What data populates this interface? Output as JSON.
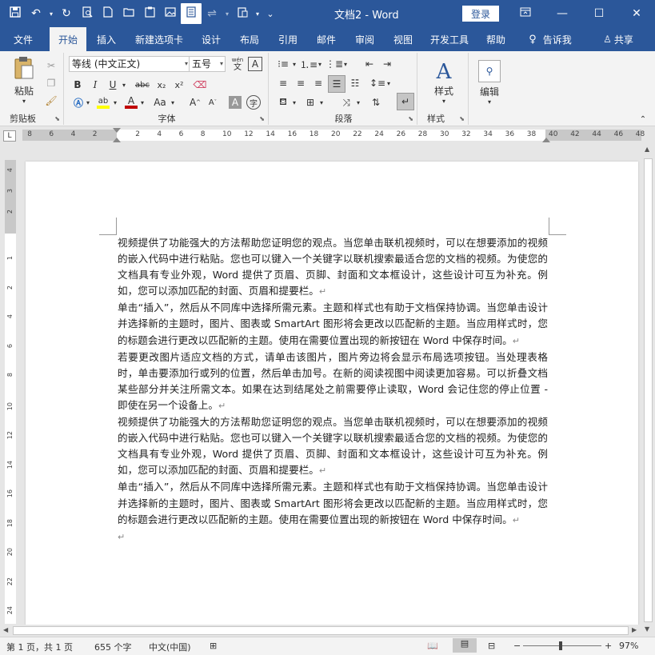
{
  "title": {
    "doc_name": "文档2",
    "sep": " - ",
    "app": "Word",
    "login": "登录"
  },
  "tabs": [
    "文件",
    "开始",
    "插入",
    "新建选项卡",
    "设计",
    "布局",
    "引用",
    "邮件",
    "审阅",
    "视图",
    "开发工具",
    "帮助"
  ],
  "tell_me": "告诉我",
  "share": "共享",
  "ribbon": {
    "clipboard": {
      "paste": "粘贴",
      "label": "剪贴板"
    },
    "font": {
      "label": "字体",
      "font_name": "等线 (中文正文)",
      "font_size": "五号",
      "wen": "wén",
      "bold": "B",
      "italic": "I",
      "underline": "U",
      "strike": "abc",
      "sub": "x₂",
      "sup": "x²",
      "case": "Aa",
      "grow": "A",
      "shrink": "A",
      "char_border": "A",
      "char_shading": "A",
      "phonetic": "A",
      "highlight": "ab",
      "font_color": "A"
    },
    "paragraph": {
      "label": "段落"
    },
    "styles": {
      "label": "样式",
      "btn": "样式"
    },
    "editing": {
      "btn": "编辑"
    }
  },
  "ruler": {
    "h_left": [
      "8",
      "6",
      "4",
      "2"
    ],
    "h_right": [
      "2",
      "4",
      "6",
      "8",
      "10",
      "12",
      "14",
      "16",
      "18",
      "20",
      "22",
      "24",
      "26",
      "28",
      "30",
      "32",
      "34",
      "36",
      "38",
      "40",
      "42",
      "44",
      "46",
      "48"
    ],
    "v": [
      "4",
      "3",
      "2",
      "1",
      "2",
      "4",
      "6",
      "8",
      "10",
      "12",
      "14",
      "16",
      "18",
      "20",
      "22",
      "24"
    ]
  },
  "document": {
    "paragraphs": [
      "视频提供了功能强大的方法帮助您证明您的观点。当您单击联机视频时，可以在想要添加的视频的嵌入代码中进行粘贴。您也可以键入一个关键字以联机搜索最适合您的文档的视频。为使您的文档具有专业外观，Word 提供了页眉、页脚、封面和文本框设计，这些设计可互为补充。例如，您可以添加匹配的封面、页眉和提要栏。",
      "单击“插入”，然后从不同库中选择所需元素。主题和样式也有助于文档保持协调。当您单击设计并选择新的主题时，图片、图表或 SmartArt 图形将会更改以匹配新的主题。当应用样式时，您的标题会进行更改以匹配新的主题。使用在需要位置出现的新按钮在 Word 中保存时间。",
      "若要更改图片适应文档的方式，请单击该图片，图片旁边将会显示布局选项按钮。当处理表格时，单击要添加行或列的位置，然后单击加号。在新的阅读视图中阅读更加容易。可以折叠文档某些部分并关注所需文本。如果在达到结尾处之前需要停止读取，Word 会记住您的停止位置 - 即使在另一个设备上。",
      "视频提供了功能强大的方法帮助您证明您的观点。当您单击联机视频时，可以在想要添加的视频的嵌入代码中进行粘贴。您也可以键入一个关键字以联机搜索最适合您的文档的视频。为使您的文档具有专业外观，Word 提供了页眉、页脚、封面和文本框设计，这些设计可互为补充。例如，您可以添加匹配的封面、页眉和提要栏。",
      "单击“插入”，然后从不同库中选择所需元素。主题和样式也有助于文档保持协调。当您单击设计并选择新的主题时，图片、图表或 SmartArt 图形将会更改以匹配新的主题。当应用样式时，您的标题会进行更改以匹配新的主题。使用在需要位置出现的新按钮在 Word 中保存时间。"
    ],
    "para_mark": "↵"
  },
  "status": {
    "page": "第 1 页，共 1 页",
    "words": "655 个字",
    "lang": "中文(中国)",
    "zoom": "97%"
  },
  "colors": {
    "accent": "#2b579a",
    "highlight": "#ffff00",
    "font_color": "#c00000"
  }
}
